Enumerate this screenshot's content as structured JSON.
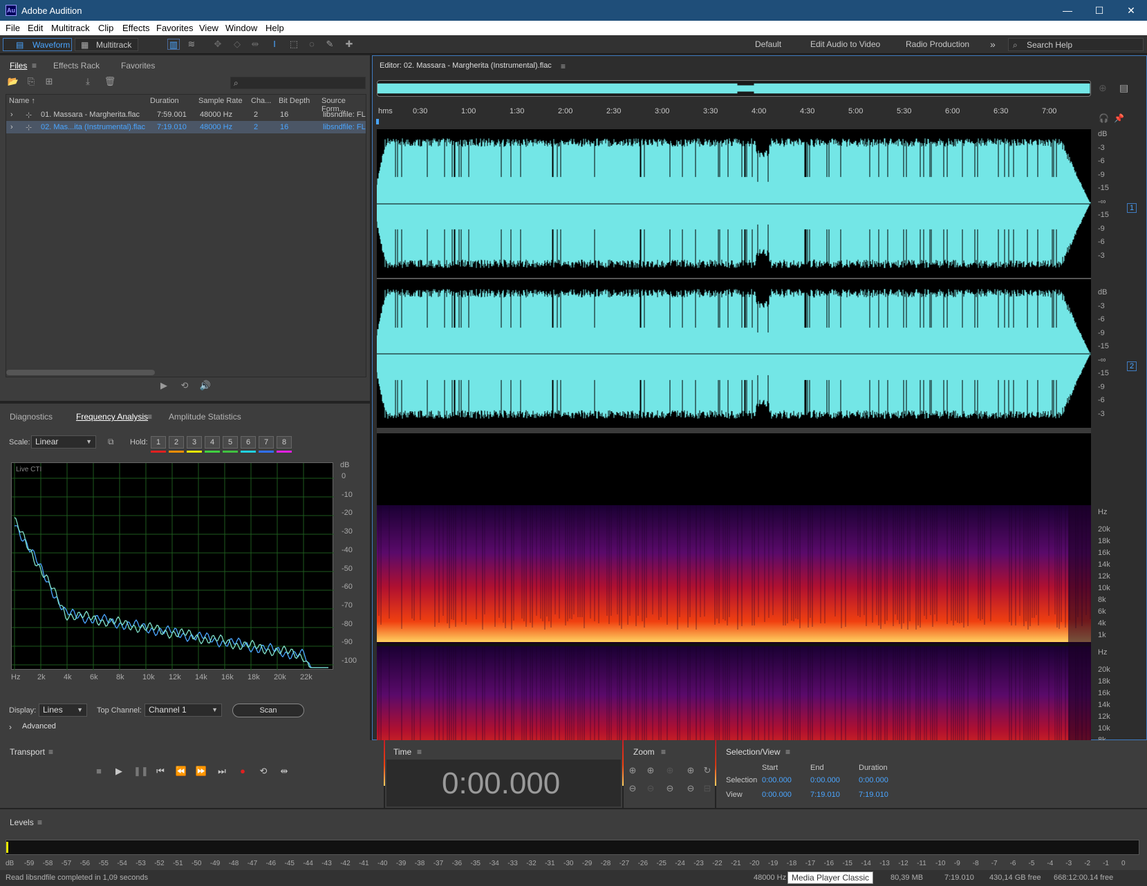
{
  "window": {
    "logo": "Au",
    "title": "Adobe Audition",
    "minimize": "—",
    "maximize": "☐",
    "close": "✕"
  },
  "menu": [
    "File",
    "Edit",
    "Multitrack",
    "Clip",
    "Effects",
    "Favorites",
    "View",
    "Window",
    "Help"
  ],
  "toolbar": {
    "waveform": "Waveform",
    "multitrack": "Multitrack",
    "workspaces": [
      "Default",
      "Edit Audio to Video",
      "Radio Production"
    ],
    "more": "»",
    "search_placeholder": "Search Help"
  },
  "files_panel": {
    "tabs": [
      "Files",
      "Effects Rack",
      "Favorites"
    ],
    "columns": [
      "Name",
      "Duration",
      "Sample Rate",
      "Cha...",
      "Bit Depth",
      "Source Form..."
    ],
    "sort_indicator": "↑",
    "rows": [
      {
        "name": "01. Massara - Margherita.flac",
        "duration": "7:59.001",
        "rate": "48000 Hz",
        "channels": "2",
        "bits": "16",
        "source": "libsndfile: FL",
        "selected": false
      },
      {
        "name": "02. Mas...ita (Instrumental).flac",
        "duration": "7:19.010",
        "rate": "48000 Hz",
        "channels": "2",
        "bits": "16",
        "source": "libsndfile: FL",
        "selected": true
      }
    ]
  },
  "freq_panel": {
    "tabs": [
      "Diagnostics",
      "Frequency Analysis",
      "Amplitude Statistics"
    ],
    "scale_label": "Scale:",
    "scale_value": "Linear",
    "hold_label": "Hold:",
    "hold_buttons": [
      "1",
      "2",
      "3",
      "4",
      "5",
      "6",
      "7",
      "8"
    ],
    "hold_colors": [
      "#e02020",
      "#f08c00",
      "#e6e600",
      "#40d040",
      "#40c040",
      "#20d0e0",
      "#3070ff",
      "#e020e0"
    ],
    "live_label": "Live CTI",
    "y_unit": "dB",
    "y_ticks": [
      "0",
      "-10",
      "-20",
      "-30",
      "-40",
      "-50",
      "-60",
      "-70",
      "-80",
      "-90",
      "-100"
    ],
    "x_ticks": [
      "Hz",
      "2k",
      "4k",
      "6k",
      "8k",
      "10k",
      "12k",
      "14k",
      "16k",
      "18k",
      "20k",
      "22k"
    ],
    "display_label": "Display:",
    "display_value": "Lines",
    "top_channel_label": "Top Channel:",
    "top_channel_value": "Channel 1",
    "scan": "Scan",
    "advanced": "Advanced"
  },
  "editor": {
    "title": "Editor: 02. Massara - Margherita (Instrumental).flac",
    "time_ticks": [
      "hms",
      "0:30",
      "1:00",
      "1:30",
      "2:00",
      "2:30",
      "3:00",
      "3:30",
      "4:00",
      "4:30",
      "5:00",
      "5:30",
      "6:00",
      "6:30",
      "7:00"
    ],
    "db_ticks_top": [
      "dB",
      "-3",
      "-6",
      "-9",
      "-15",
      "-∞",
      "-15",
      "-9",
      "-6",
      "-3"
    ],
    "db_ticks_bottom": [
      "dB",
      "-3",
      "-6",
      "-9",
      "-15",
      "-∞",
      "-15",
      "-9",
      "-6",
      "-3"
    ],
    "channel_labels": [
      "1",
      "2"
    ],
    "hz_ticks": [
      "Hz",
      "20k",
      "18k",
      "16k",
      "14k",
      "12k",
      "10k",
      "8k",
      "6k",
      "4k",
      "1k"
    ]
  },
  "transport": {
    "title": "Transport"
  },
  "time_panel": {
    "title": "Time",
    "value": "0:00.000"
  },
  "zoom_panel": {
    "title": "Zoom"
  },
  "selection_panel": {
    "title": "Selection/View",
    "col_start": "Start",
    "col_end": "End",
    "col_duration": "Duration",
    "selection_label": "Selection",
    "view_label": "View",
    "selection": {
      "start": "0:00.000",
      "end": "0:00.000",
      "duration": "0:00.000"
    },
    "view": {
      "start": "0:00.000",
      "end": "7:19.010",
      "duration": "7:19.010"
    }
  },
  "levels": {
    "title": "Levels",
    "scale": [
      "dB",
      "-59",
      "-58",
      "-57",
      "-56",
      "-55",
      "-54",
      "-53",
      "-52",
      "-51",
      "-50",
      "-49",
      "-48",
      "-47",
      "-46",
      "-45",
      "-44",
      "-43",
      "-42",
      "-41",
      "-40",
      "-39",
      "-38",
      "-37",
      "-36",
      "-35",
      "-34",
      "-33",
      "-32",
      "-31",
      "-30",
      "-29",
      "-28",
      "-27",
      "-26",
      "-25",
      "-24",
      "-23",
      "-22",
      "-21",
      "-20",
      "-19",
      "-18",
      "-17",
      "-16",
      "-15",
      "-14",
      "-13",
      "-12",
      "-11",
      "-10",
      "-9",
      "-8",
      "-7",
      "-6",
      "-5",
      "-4",
      "-3",
      "-2",
      "-1",
      "0"
    ]
  },
  "status": {
    "message": "Read libsndfile completed in 1,09 seconds",
    "sample_rate": "48000 Hz",
    "tooltip": "Media Player Classic",
    "size": "80,39 MB",
    "duration": "7:19.010",
    "free": "430,14 GB free",
    "free_time": "668:12:00.14 free"
  }
}
